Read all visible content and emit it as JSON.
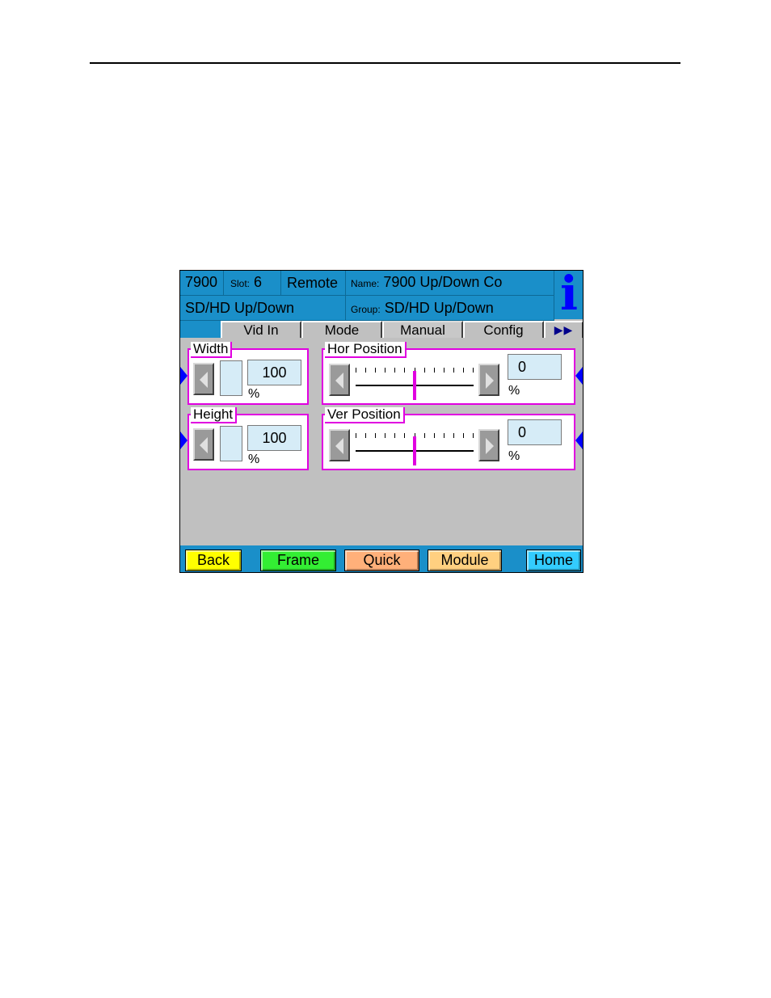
{
  "header": {
    "model": "7900",
    "slot_label": "Slot:",
    "slot_value": "6",
    "mode": "Remote",
    "name_label": "Name:",
    "name_value": "7900 Up/Down Co",
    "product": "SD/HD Up/Down",
    "group_label": "Group:",
    "group_value": "SD/HD Up/Down",
    "info_glyph": "i"
  },
  "tabs": [
    {
      "label": "Vid In"
    },
    {
      "label": "Mode"
    },
    {
      "label": "Manual",
      "active": true
    },
    {
      "label": "Config"
    },
    {
      "label": "▶▶"
    }
  ],
  "controls": {
    "width": {
      "label": "Width",
      "value": "100",
      "unit": "%"
    },
    "height": {
      "label": "Height",
      "value": "100",
      "unit": "%"
    },
    "hor_position": {
      "label": "Hor Position",
      "value": "0",
      "unit": "%",
      "slider_fraction": 0.5
    },
    "ver_position": {
      "label": "Ver Position",
      "value": "0",
      "unit": "%",
      "slider_fraction": 0.5
    }
  },
  "nav": {
    "back": "Back",
    "frame": "Frame",
    "quick": "Quick",
    "module": "Module",
    "home": "Home"
  },
  "colors": {
    "header_bg": "#1a8fc9",
    "group_border": "#e000e0",
    "back": "#ffff00",
    "frame": "#33ee33",
    "quick": "#ffb07a",
    "module": "#ffd080",
    "home": "#33ccff"
  }
}
